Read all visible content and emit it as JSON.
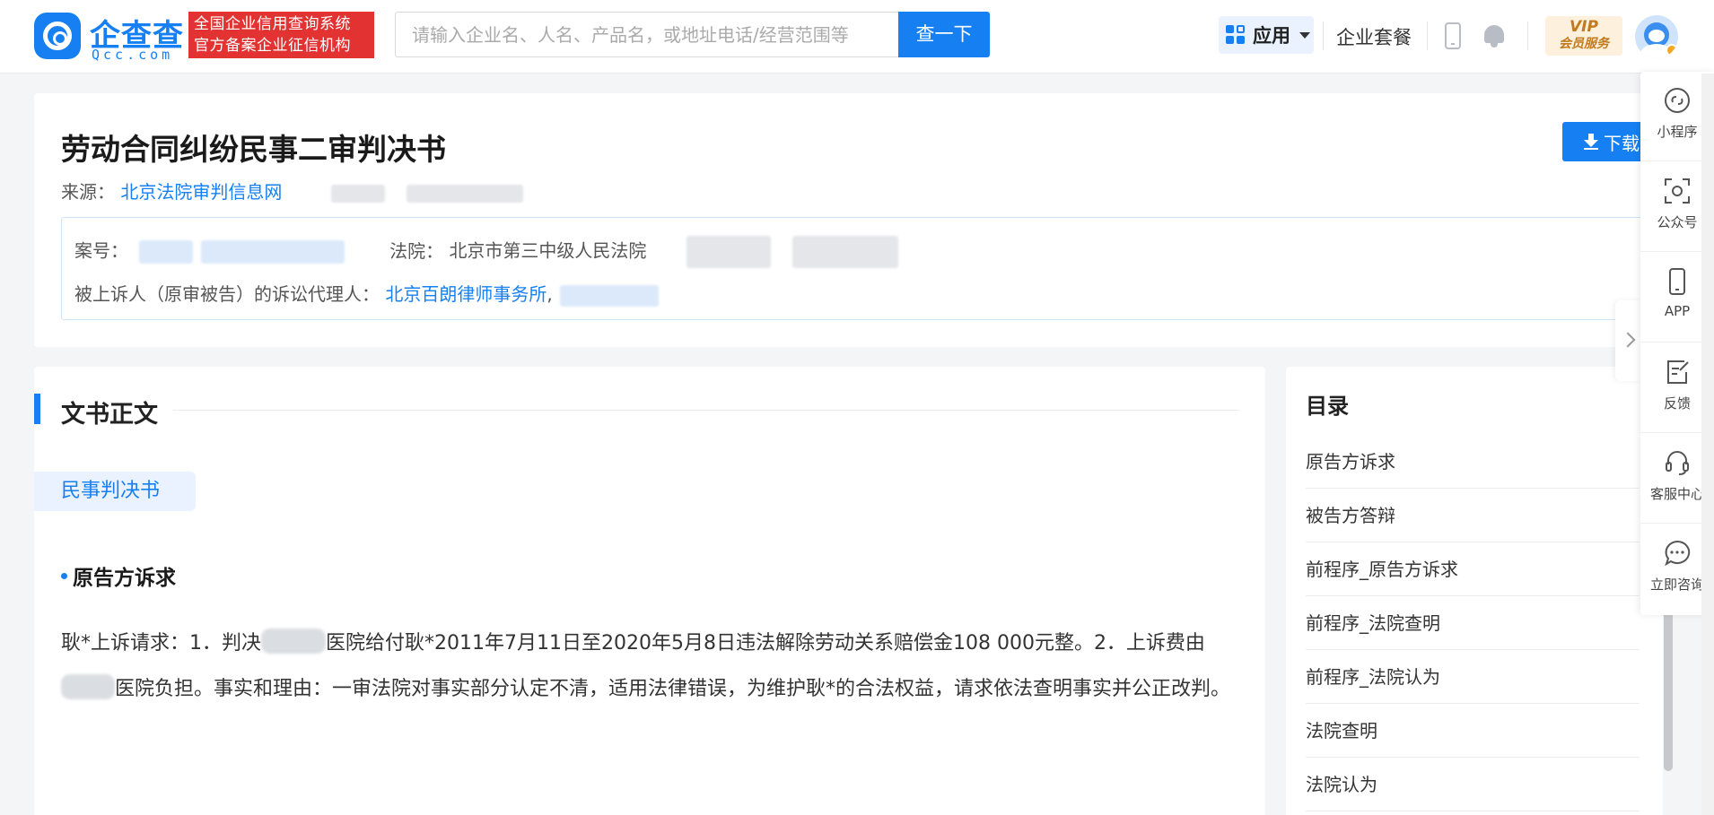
{
  "header": {
    "logo_name": "企查查",
    "logo_domain": "Qcc.com",
    "slogan_line1": "全国企业信用查询系统",
    "slogan_line2": "官方备案企业征信机构",
    "search_placeholder": "请输入企业名、人名、产品名，或地址电话/经营范围等",
    "search_button": "查一下",
    "apps_label": "应用",
    "packages_label": "企业套餐",
    "vip_top": "VIP",
    "vip_bottom": "会员服务"
  },
  "document": {
    "title": "劳动合同纠纷民事二审判决书",
    "download_label": "下载",
    "source_label": "来源：",
    "source_value": "北京法院审判信息网",
    "case_no_label": "案号：",
    "court_label": "法院：",
    "court_value": "北京市第三中级人民法院",
    "agent_label": "被上诉人（原审被告）的诉讼代理人：",
    "agent_value": "北京百朗律师事务所",
    "agent_sep": ","
  },
  "body": {
    "section_title": "文书正文",
    "doc_type": "民事判决书",
    "sub_heading": "原告方诉求",
    "para_part1": "耿*上诉请求：1．判决",
    "para_part2": "医院给付耿*2011年7月11日至2020年5月8日违法解除劳动关系赔偿金108 000元整。2．上诉费由",
    "para_part3": "医院负担。事实和理由：一审法院对事实部分认定不清，适用法律错误，为维护耿*的合法权益，请求依法查明事实并公正改判。"
  },
  "toc": {
    "title": "目录",
    "items": [
      "原告方诉求",
      "被告方答辩",
      "前程序_原告方诉求",
      "前程序_法院查明",
      "前程序_法院认为",
      "法院查明",
      "法院认为"
    ]
  },
  "float_bar": {
    "items": [
      {
        "label": "小程序",
        "icon": "mini-program-icon"
      },
      {
        "label": "公众号",
        "icon": "official-account-icon"
      },
      {
        "label": "APP",
        "icon": "mobile-app-icon"
      },
      {
        "label": "反馈",
        "icon": "feedback-icon"
      },
      {
        "label": "客服中心",
        "icon": "headset-icon"
      },
      {
        "label": "立即咨询",
        "icon": "chat-bubble-icon"
      }
    ]
  },
  "colors": {
    "brand_blue": "#1680f3",
    "slogan_red": "#e23232",
    "vip_gold": "#c17a1d"
  }
}
